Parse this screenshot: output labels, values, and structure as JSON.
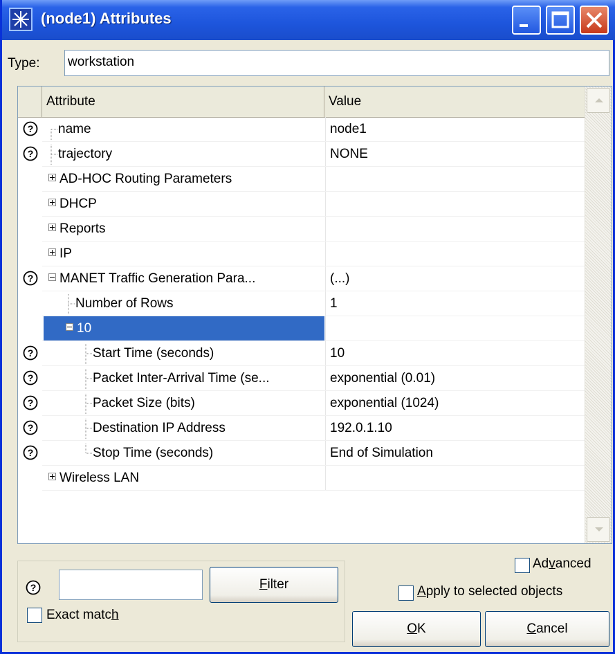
{
  "window": {
    "title": "(node1) Attributes"
  },
  "type_field": {
    "label": "Type:",
    "value": "workstation"
  },
  "grid": {
    "columns": [
      "Attribute",
      "Value"
    ],
    "rows": [
      {
        "attr": "name",
        "value": "node1",
        "help": true,
        "indent": 1,
        "connector": "top"
      },
      {
        "attr": "trajectory",
        "value": "NONE",
        "help": true,
        "indent": 1,
        "connector": "mid"
      },
      {
        "attr": "AD-HOC Routing Parameters",
        "value": "",
        "help": false,
        "indent": 1,
        "expander": "plus"
      },
      {
        "attr": "DHCP",
        "value": "",
        "help": false,
        "indent": 1,
        "expander": "plus"
      },
      {
        "attr": "Reports",
        "value": "",
        "help": false,
        "indent": 1,
        "expander": "plus"
      },
      {
        "attr": "IP",
        "value": "",
        "help": false,
        "indent": 1,
        "expander": "plus"
      },
      {
        "attr": "MANET Traffic Generation Para...",
        "value": "(...)",
        "help": true,
        "indent": 1,
        "expander": "minus"
      },
      {
        "attr": "Number of Rows",
        "value": "1",
        "help": false,
        "indent": 2,
        "connector": "mid"
      },
      {
        "attr": "10",
        "value": "",
        "help": false,
        "indent": 2,
        "expander": "minus",
        "selected": true
      },
      {
        "attr": "Start Time (seconds)",
        "value": "10",
        "help": true,
        "indent": 3,
        "connector": "mid"
      },
      {
        "attr": "Packet Inter-Arrival Time (se...",
        "value": "exponential (0.01)",
        "help": true,
        "indent": 3,
        "connector": "mid"
      },
      {
        "attr": "Packet Size (bits)",
        "value": "exponential (1024)",
        "help": true,
        "indent": 3,
        "connector": "mid"
      },
      {
        "attr": "Destination IP Address",
        "value": "192.0.1.10",
        "help": true,
        "indent": 3,
        "connector": "mid"
      },
      {
        "attr": "Stop Time (seconds)",
        "value": "End of Simulation",
        "help": true,
        "indent": 3,
        "connector": "end"
      },
      {
        "attr": "Wireless LAN",
        "value": "",
        "help": false,
        "indent": 1,
        "expander": "plus"
      }
    ]
  },
  "filter": {
    "value": "",
    "button_pre": "",
    "button_ul": "F",
    "button_post": "ilter"
  },
  "exact_match": {
    "pre": "Exact matc",
    "ul": "h",
    "post": "",
    "checked": false
  },
  "advanced": {
    "pre": "Ad",
    "ul": "v",
    "post": "anced",
    "checked": false
  },
  "apply_selected": {
    "pre": "",
    "ul": "A",
    "post": "pply to selected objects",
    "checked": false
  },
  "ok_button": {
    "pre": "",
    "ul": "O",
    "post": "K"
  },
  "cancel_button": {
    "pre": "",
    "ul": "C",
    "post": "ancel"
  },
  "icons": {
    "help": "question-mark-circle",
    "expand": "plus-box",
    "collapse": "minus-box"
  }
}
